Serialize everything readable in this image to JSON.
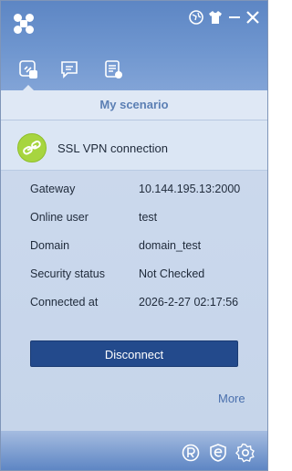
{
  "header": {
    "logo": "app-logo",
    "title_buttons": [
      "globe-icon",
      "shirt-icon",
      "minimize-icon",
      "close-icon"
    ],
    "tabs": [
      {
        "icon": "scenario-icon",
        "active": true
      },
      {
        "icon": "message-icon",
        "active": false
      },
      {
        "icon": "log-icon",
        "active": false
      }
    ]
  },
  "scenario_bar": {
    "title": "My scenario"
  },
  "connection": {
    "title": "SSL VPN connection",
    "icon": "link-icon",
    "icon_color": "#a7d53f"
  },
  "details": [
    {
      "label": "Gateway",
      "value": "10.144.195.13:2000"
    },
    {
      "label": "Online user",
      "value": "test"
    },
    {
      "label": "Domain",
      "value": "domain_test"
    },
    {
      "label": "Security status",
      "value": "Not Checked"
    },
    {
      "label": "Connected at",
      "value": "2026-2-27 02:17:56"
    }
  ],
  "actions": {
    "disconnect_label": "Disconnect",
    "more_label": "More"
  },
  "footer": {
    "buttons": [
      "registered-icon",
      "edge-icon",
      "settings-icon"
    ]
  },
  "colors": {
    "accent": "#234a8c",
    "header": "#6f96cf",
    "panel": "#c9d7ec"
  }
}
